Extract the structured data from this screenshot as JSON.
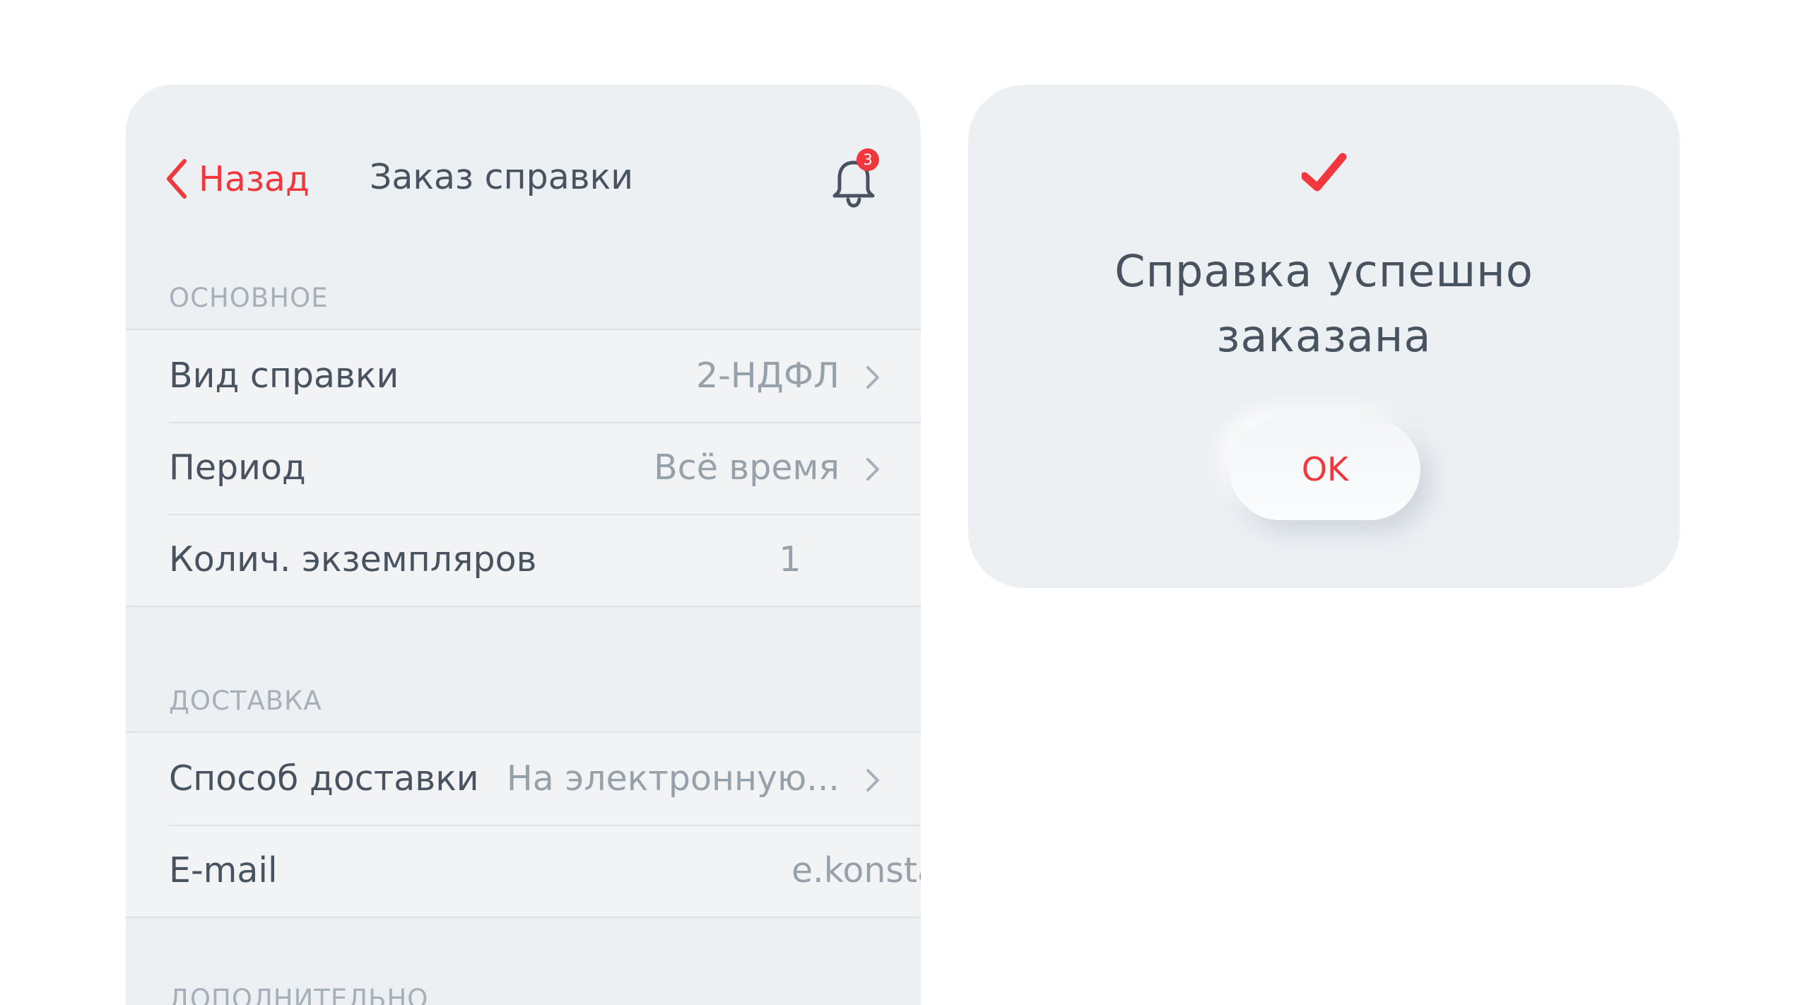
{
  "nav": {
    "back_label": "Назад",
    "title": "Заказ справки",
    "notifications_count": "3"
  },
  "sections": {
    "main": {
      "header": "ОСНОВНОЕ",
      "rows": [
        {
          "label": "Вид справки",
          "value": "2-НДФЛ"
        },
        {
          "label": "Период",
          "value": "Всё время"
        },
        {
          "label": "Колич. экземпляров",
          "value": "1"
        }
      ]
    },
    "delivery": {
      "header": "ДОСТАВКА",
      "rows": [
        {
          "label": "Способ доставки",
          "value": "На электронную..."
        },
        {
          "label": "E-mail",
          "value": "e.konsta"
        }
      ]
    },
    "additional": {
      "header": "ДОПОЛНИТЕЛЬНО"
    }
  },
  "dialog": {
    "title_line1": "Справка успешно",
    "title_line2": "заказана",
    "ok_label": "OK"
  },
  "colors": {
    "accent": "#f0383e",
    "panel_bg": "#edf0f3",
    "text_primary": "#48535f",
    "text_secondary": "#97a1aa"
  },
  "icons": [
    "chevron-left-icon",
    "bell-icon",
    "chevron-right-icon",
    "checkmark-icon"
  ]
}
